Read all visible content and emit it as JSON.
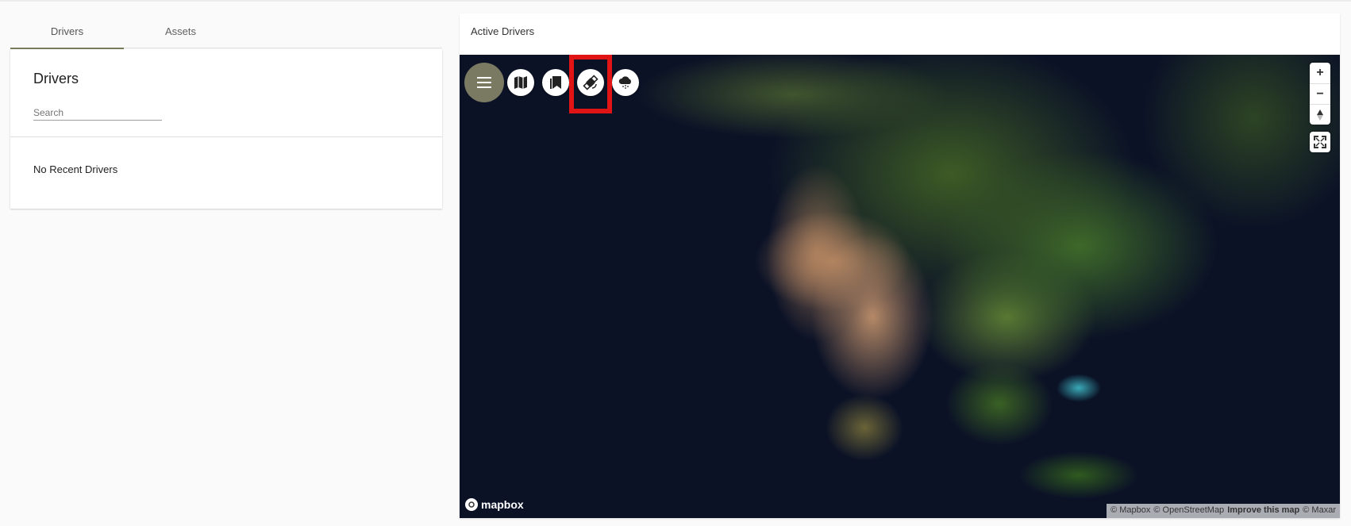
{
  "tabs": [
    {
      "label": "Drivers",
      "active": true
    },
    {
      "label": "Assets",
      "active": false
    }
  ],
  "drivers": {
    "title": "Drivers",
    "search_placeholder": "Search",
    "empty_message": "No Recent Drivers"
  },
  "map": {
    "header": "Active Drivers",
    "toolbar": [
      "menu-icon",
      "map-icon",
      "bookmark-icon",
      "satellite-icon",
      "weather-icon"
    ],
    "highlighted_tool": "satellite-icon",
    "controls": {
      "zoom_in": "+",
      "zoom_out": "−"
    },
    "logo": "mapbox",
    "attribution": {
      "mapbox": "© Mapbox",
      "osm": "© OpenStreetMap",
      "improve": "Improve this map",
      "maxar": "© Maxar"
    }
  },
  "colors": {
    "menu_button": "#7a7a62",
    "highlight": "#e01414",
    "tab_indicator": "#7a7a5c"
  }
}
